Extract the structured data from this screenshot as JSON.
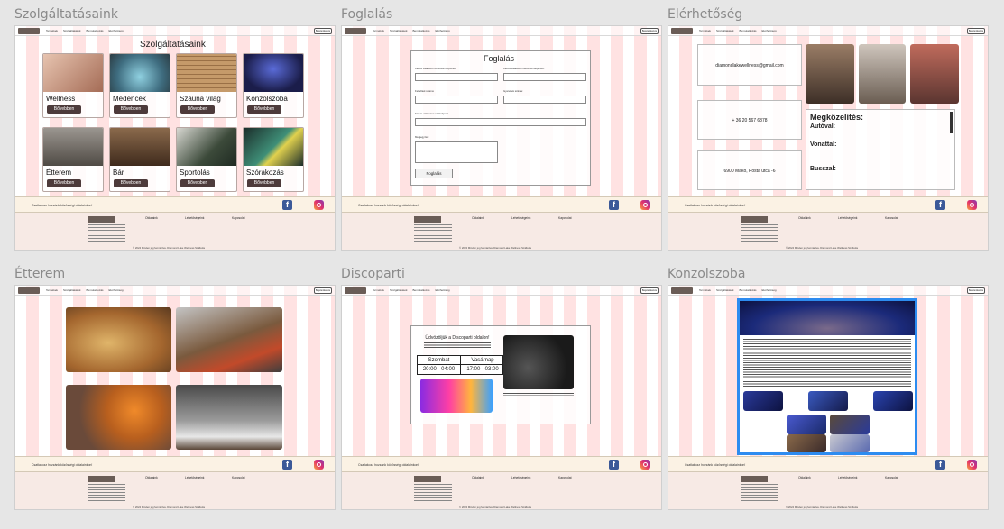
{
  "frames": {
    "szolgaltatasaink": {
      "label": "Szolgáltatásaink",
      "page_title": "Szolgáltatásaink"
    },
    "foglalas": {
      "label": "Foglalás",
      "form_title": "Foglalás"
    },
    "elerhetoseg": {
      "label": "Elérhetőség"
    },
    "etterem": {
      "label": "Étterem"
    },
    "discoparti": {
      "label": "Discoparti"
    },
    "konzolszoba": {
      "label": "Konzolszoba"
    }
  },
  "nav": {
    "items": [
      "Termékek",
      "Szolgáltatások",
      "Bemutatkozás",
      "Elérhetőség"
    ],
    "button": "Bejelentkezés"
  },
  "services": [
    {
      "name": "Wellness",
      "button": "Bővebben",
      "color": "#c89a84"
    },
    {
      "name": "Medencék",
      "button": "Bővebben",
      "color": "#5a8fa6"
    },
    {
      "name": "Szauna világ",
      "button": "Bővebben",
      "color": "#b78e63"
    },
    {
      "name": "Konzolszoba",
      "button": "Bővebben",
      "color": "#2b2f64"
    },
    {
      "name": "Étterem",
      "button": "Bővebben",
      "color": "#6f6a63"
    },
    {
      "name": "Bár",
      "button": "Bővebben",
      "color": "#6d4d35"
    },
    {
      "name": "Sportolás",
      "button": "Bővebben",
      "color": "#4f5a4b"
    },
    {
      "name": "Szórakozás",
      "button": "Bővebben",
      "color": "#2f4b45"
    }
  ],
  "booking": {
    "fields": [
      "Kérem válasszon érkezési időpontot:",
      "Kérem válasszon távozási időpontot:",
      "Felnőttek száma:",
      "Gyerekek száma:",
      "Kérem válasszon szobatípust:",
      "Megjegyzés:"
    ],
    "submit": "Foglalás"
  },
  "contact": {
    "email": "diamondlakewellness@gmail.com",
    "phone": "+ 36 20 567 6878",
    "address": "6900 Makó, Posta utca -6",
    "approach_title": "Megközelítés:",
    "approach_modes": [
      "Autóval:",
      "Vonattal:",
      "Busszal:"
    ]
  },
  "disco": {
    "title": "Üdvözöljük a Discoparti oldalon!",
    "days": [
      "Szombat",
      "Vasárnap"
    ],
    "hours": [
      "20:00 - 04:00",
      "17:00 - 03:00"
    ]
  },
  "banner": {
    "text": "Csatlakozz hozzánk közösségi oldalainkon!"
  },
  "footer": {
    "col1": "Oldalaink",
    "col2": "Lehetőségeink",
    "col3": "Kapcsolat",
    "copyright": "© 2024 Minden jog fenntartva. Diamond Lake Wellness Szálloda"
  },
  "colors": {
    "grid": "#ff9696",
    "button": "#4d3b3b",
    "selection": "#2d8cf0"
  }
}
